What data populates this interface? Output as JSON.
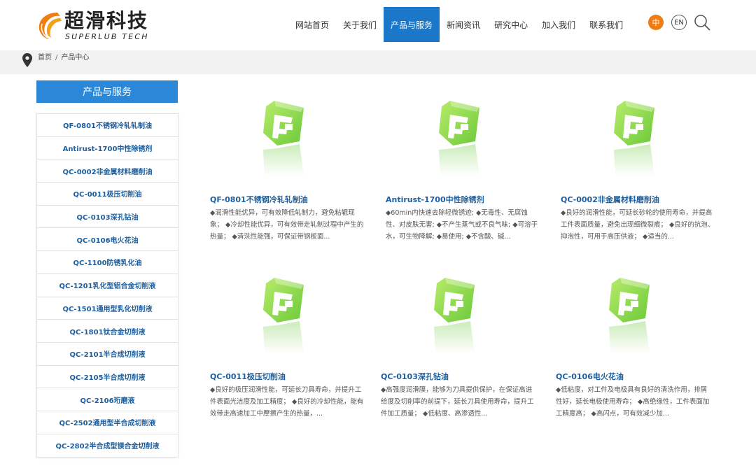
{
  "header": {
    "logo_cn": "超滑科技",
    "logo_en": "SUPERLUB TECH",
    "nav": [
      {
        "label": "网站首页",
        "active": false
      },
      {
        "label": "关于我们",
        "active": false
      },
      {
        "label": "产品与服务",
        "active": true
      },
      {
        "label": "新闻资讯",
        "active": false
      },
      {
        "label": "研究中心",
        "active": false
      },
      {
        "label": "加入我们",
        "active": false
      },
      {
        "label": "联系我们",
        "active": false
      }
    ],
    "lang_cn": "中",
    "lang_en": "EN"
  },
  "breadcrumb": {
    "home": "首页",
    "separator": "/",
    "current": "产品中心"
  },
  "sidebar": {
    "title": "产品与服务",
    "items": [
      "QF-0801不锈钢冷轧轧制油",
      "Antirust-1700中性除锈剂",
      "QC-0002非金属材料磨削油",
      "QC-0011极压切削油",
      "QC-0103深孔钻油",
      "QC-0106电火花油",
      "QC-1100防锈乳化油",
      "QC-1201乳化型铝合金切削液",
      "QC-1501通用型乳化切削液",
      "QC-1801钛合金切削液",
      "QC-2101半合成切削液",
      "QC-2105半合成切削液",
      "QC-2106珩磨液",
      "QC-2502通用型半合成切削液",
      "QC-2802半合成型镁合金切削液"
    ]
  },
  "products": [
    {
      "title": "QF-0801不锈钢冷轧轧制油",
      "desc": "◆润滑性能优异，可有效降低轧制力，避免粘辊现象； ◆冷却性能优异，可有效带走轧制过程中产生的热量； ◆清洗性能强，可保证带钢板面..."
    },
    {
      "title": "Antirust-1700中性除锈剂",
      "desc": "◆60min内快速去除轻微锈迹; ◆无毒性、无腐蚀性、对皮肤无害; ◆不产生蒸气或不良气味; ◆可溶于水，可生物降解; ◆易使用; ◆不含酸、碱..."
    },
    {
      "title": "QC-0002非金属材料磨削油",
      "desc": "◆良好的润滑性能，可延长砂轮的使用寿命，并提高工件表面质量，避免出现细微裂痕； ◆良好的抗泡、抑泡性，可用于高压供液； ◆适当的..."
    },
    {
      "title": "QC-0011极压切削油",
      "desc": "◆良好的极压润滑性能，可延长刀具寿命，并提升工件表面光洁度及加工精度； ◆良好的冷却性能，能有效带走高速加工中摩擦产生的热量，..."
    },
    {
      "title": "QC-0103深孔钻油",
      "desc": "◆高强度润滑膜，能够为刀具提供保护，在保证高进给度及切削率的前提下，延长刀具使用寿命，提升工件加工质量； ◆低粘度、高渗透性..."
    },
    {
      "title": "QC-0106电火花油",
      "desc": "◆低粘度，对工件及电极具有良好的清洗作用，排屑性好，延长电极使用寿命； ◆高绝缘性，工件表面加工精度高； ◆高闪点，可有效减少加..."
    }
  ],
  "colors": {
    "accent_blue": "#1a77c9",
    "sidebar_title_blue": "#2b87d8",
    "link_blue": "#1d5f9e",
    "lang_orange": "#f07c12",
    "product_green": "#6cc93a"
  }
}
